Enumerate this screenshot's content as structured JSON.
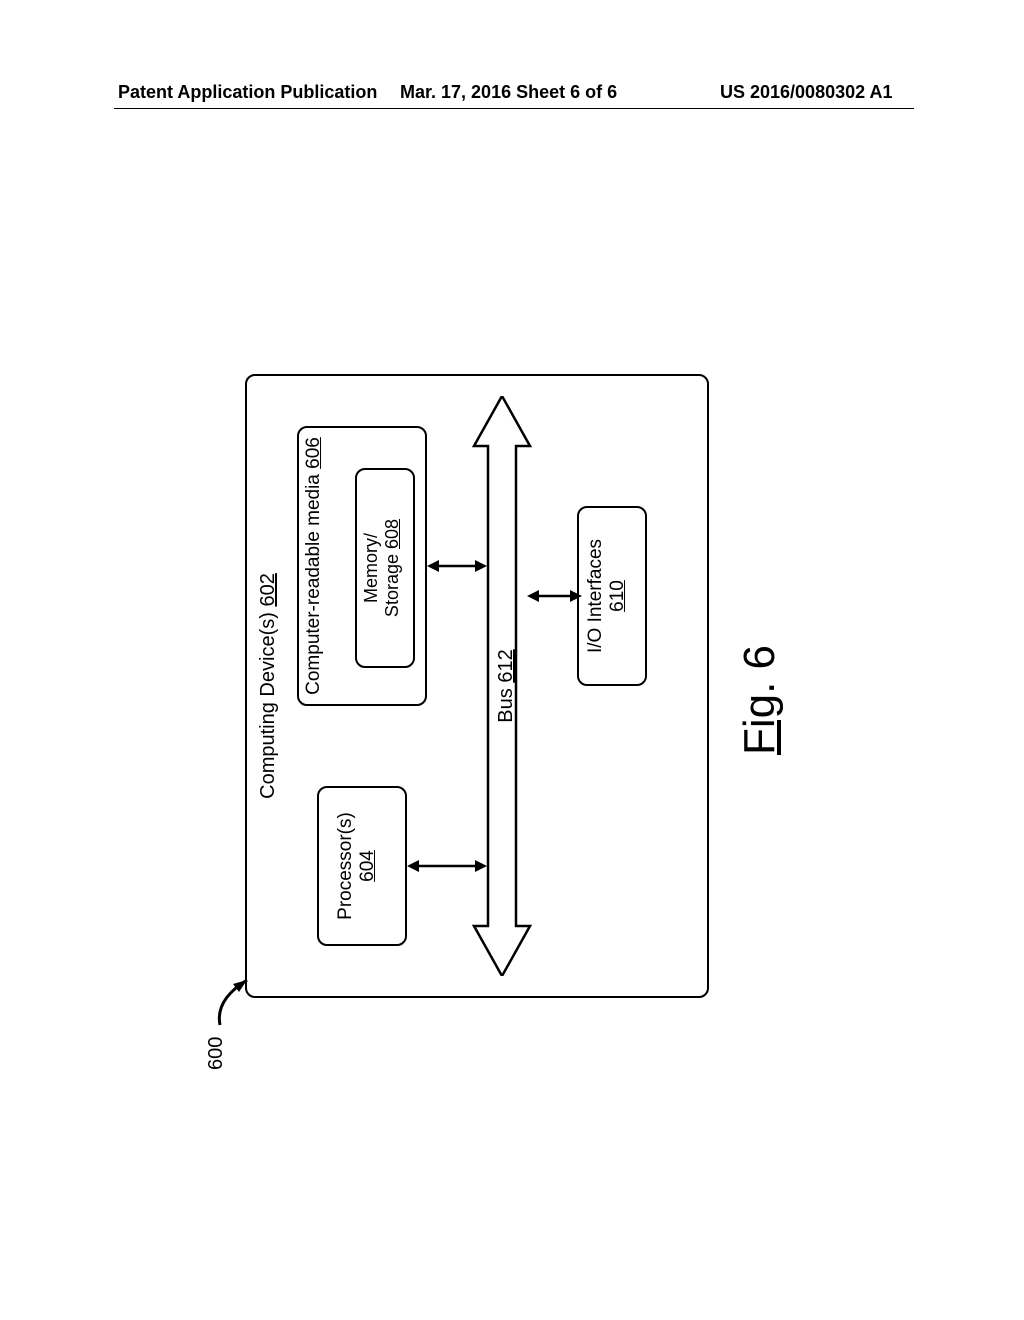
{
  "header": {
    "left": "Patent Application Publication",
    "center": "Mar. 17, 2016  Sheet 6 of 6",
    "right": "US 2016/0080302 A1"
  },
  "figure": {
    "ref_number": "600",
    "outer": {
      "label": "Computing Device(s)",
      "num": "602"
    },
    "processor": {
      "label": "Processor(s)",
      "num": "604"
    },
    "media": {
      "label": "Computer-readable media",
      "num": "606"
    },
    "memory": {
      "label_line1": "Memory/",
      "label_line2": "Storage",
      "num": "608"
    },
    "io": {
      "label": "I/O Interfaces",
      "num": "610"
    },
    "bus": {
      "label": "Bus",
      "num": "612"
    },
    "caption_prefix": "Fig",
    "caption_num": ". 6"
  }
}
